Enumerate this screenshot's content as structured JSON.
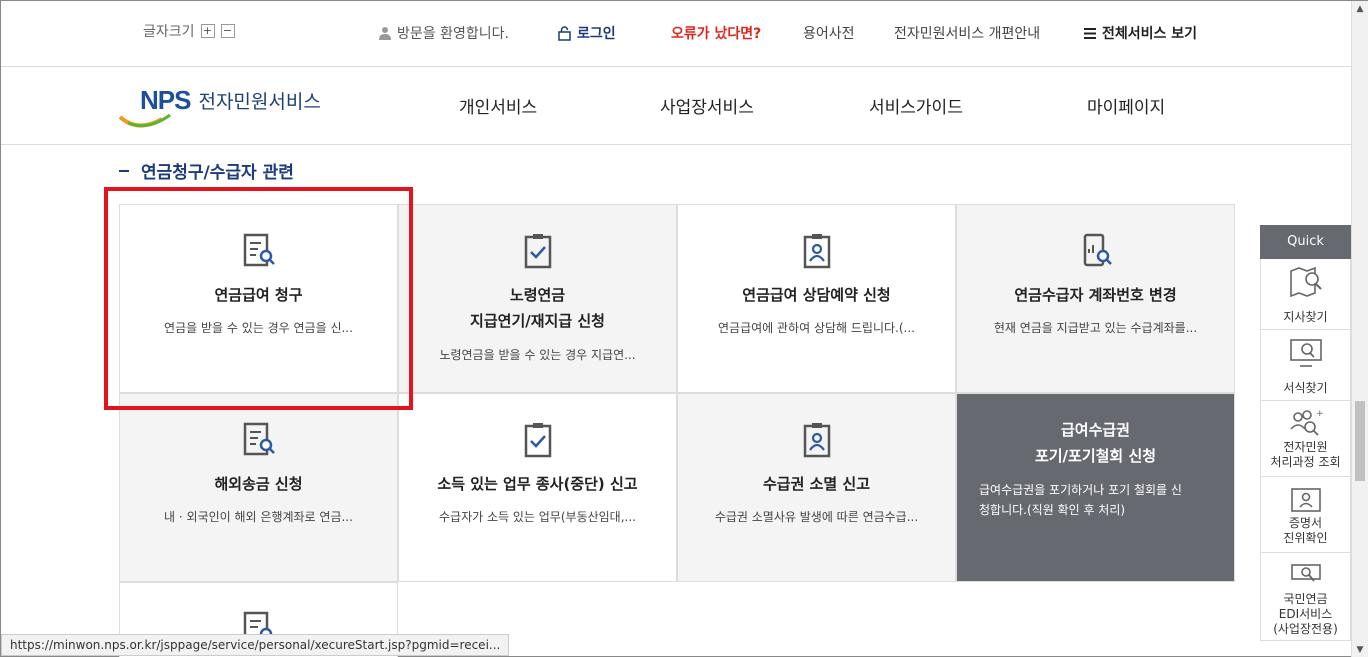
{
  "topbar": {
    "font_size_label": "글자크기",
    "font_plus": "+",
    "font_minus": "−",
    "welcome": "방문을 환영합니다.",
    "login": "로그인",
    "error": "오류가 났다면?",
    "dictionary": "용어사전",
    "renewal_notice": "전자민원서비스 개편안내",
    "all_services": "전체서비스 보기"
  },
  "header": {
    "logo_mark": "NPS",
    "logo_text": "전자민원서비스",
    "nav": [
      "개인서비스",
      "사업장서비스",
      "서비스가이드",
      "마이페이지"
    ]
  },
  "section": {
    "title": "연금청구/수급자 관련"
  },
  "cards": [
    {
      "title": "연금급여 청구",
      "desc": "연금을 받을 수 있는 경우 연금을 신..."
    },
    {
      "title": "노령연금",
      "title2": "지급연기/재지급 신청",
      "desc": "노령연금을 받을 수 있는 경우 지급연..."
    },
    {
      "title": "연금급여 상담예약 신청",
      "desc": "연금급여에 관하여 상담해 드립니다.(..."
    },
    {
      "title": "연금수급자 계좌번호 변경",
      "desc": "현재 연금을 지급받고 있는 수급계좌를..."
    },
    {
      "title": "해외송금 신청",
      "desc": "내 · 외국인이 해외 은행계좌로 연금..."
    },
    {
      "title": "소득 있는 업무 종사(중단) 신고",
      "desc": "수급자가 소득 있는 업무(부동산임대,..."
    },
    {
      "title": "수급권 소멸 신고",
      "desc": "수급권 소멸사유 발생에 따른 연금수급..."
    },
    {
      "title": "급여수급권",
      "title2": "포기/포기철회 신청",
      "desc": "급여수급권을 포기하거나 포기 철회를 신",
      "desc2": "청합니다.(직원 확인 후 처리)"
    }
  ],
  "quick": {
    "header": "Quick",
    "items": [
      {
        "label": "지사찾기",
        "icon": "map-search-icon"
      },
      {
        "label": "서식찾기",
        "icon": "monitor-search-icon"
      },
      {
        "label": "전자민원",
        "label2": "처리과정 조회",
        "icon": "people-search-icon"
      },
      {
        "label": "증명서",
        "label2": "진위확인",
        "icon": "id-card-icon"
      },
      {
        "label": "국민연금",
        "label2": "EDI서비스",
        "label3": "(사업장전용)",
        "icon": "edi-icon"
      }
    ]
  },
  "statusbar": {
    "url": "https://minwon.nps.or.kr/jsppage/service/personal/xecureStart.jsp?pgmid=recei..."
  },
  "colors": {
    "brand": "#1b3b7a",
    "error": "#e0261b",
    "highlight": "#e3141b",
    "dark_card": "#666a70"
  }
}
